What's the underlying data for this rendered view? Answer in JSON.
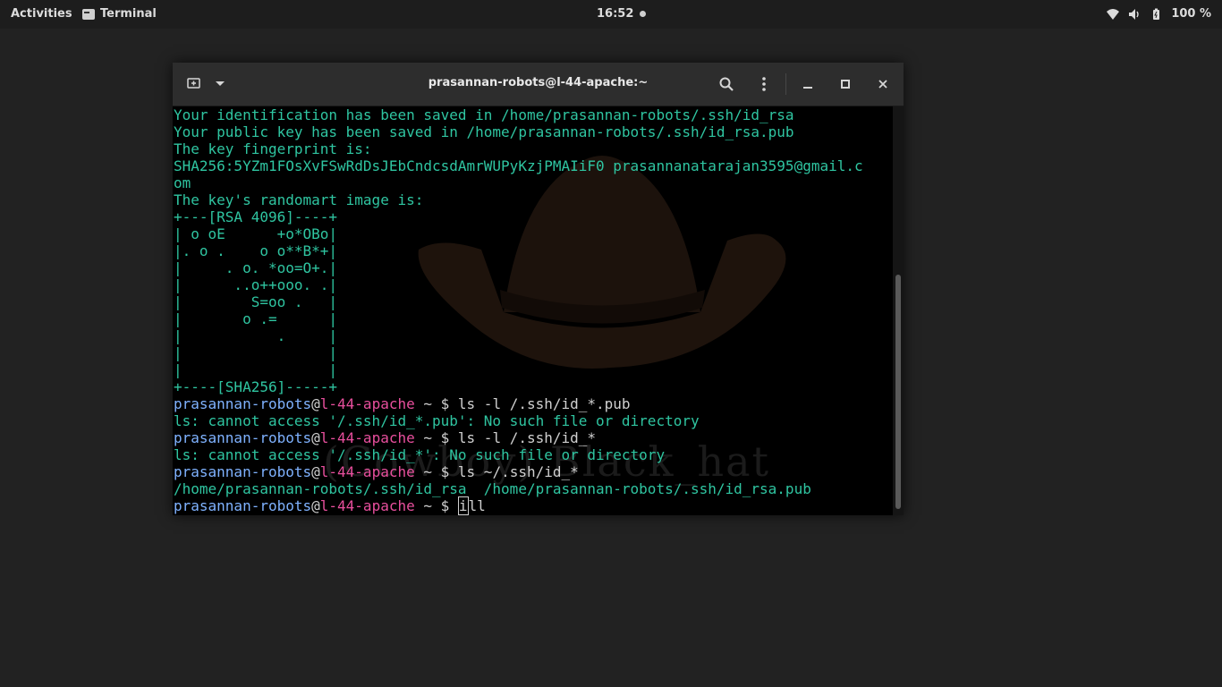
{
  "topbar": {
    "activities": "Activities",
    "app_name": "Terminal",
    "clock": "16:52",
    "battery": "100 %",
    "icons": [
      "wifi-icon",
      "volume-icon",
      "battery-icon"
    ]
  },
  "window": {
    "title": "prasannan-robots@l-44-apache:~",
    "buttons": [
      "new-tab-icon",
      "chevron-down-icon",
      "search-icon",
      "kebab-menu-icon",
      "minimize-icon",
      "maximize-icon",
      "close-icon"
    ]
  },
  "terminal": {
    "watermark": "(Cowboy) Black_hat",
    "lines": [
      "Your identification has been saved in /home/prasannan-robots/.ssh/id_rsa",
      "Your public key has been saved in /home/prasannan-robots/.ssh/id_rsa.pub",
      "The key fingerprint is:",
      "SHA256:5YZm1FOsXvFSwRdDsJEbCndcsdAmrWUPyKzjPMAIiF0 prasannanatarajan3595@gmail.c",
      "om",
      "The key's randomart image is:",
      "+---[RSA 4096]----+",
      "| o oE      +o*OBo|",
      "|. o .    o o**B*+|",
      "|     . o. *oo=O+.|",
      "|      ..o++ooo. .|",
      "|        S=oo .   |",
      "|       o .=      |",
      "|           .     |",
      "|                 |",
      "|                 |",
      "+----[SHA256]-----+"
    ],
    "prompt_user": "prasannan-robots",
    "prompt_at": "@",
    "prompt_host": "l-44-apache",
    "prompt_tail": " ~ $ ",
    "cmd1": "ls -l /.ssh/id_*.pub",
    "out1": "ls: cannot access '/.ssh/id_*.pub': No such file or directory",
    "cmd2": "ls -l /.ssh/id_*",
    "out2": "ls: cannot access '/.ssh/id_*': No such file or directory",
    "cmd3": "ls ~/.ssh/id_*",
    "out3": "/home/prasannan-robots/.ssh/id_rsa  /home/prasannan-robots/.ssh/id_rsa.pub",
    "current_input_cursor": "i",
    "current_input_rest": "ll"
  }
}
